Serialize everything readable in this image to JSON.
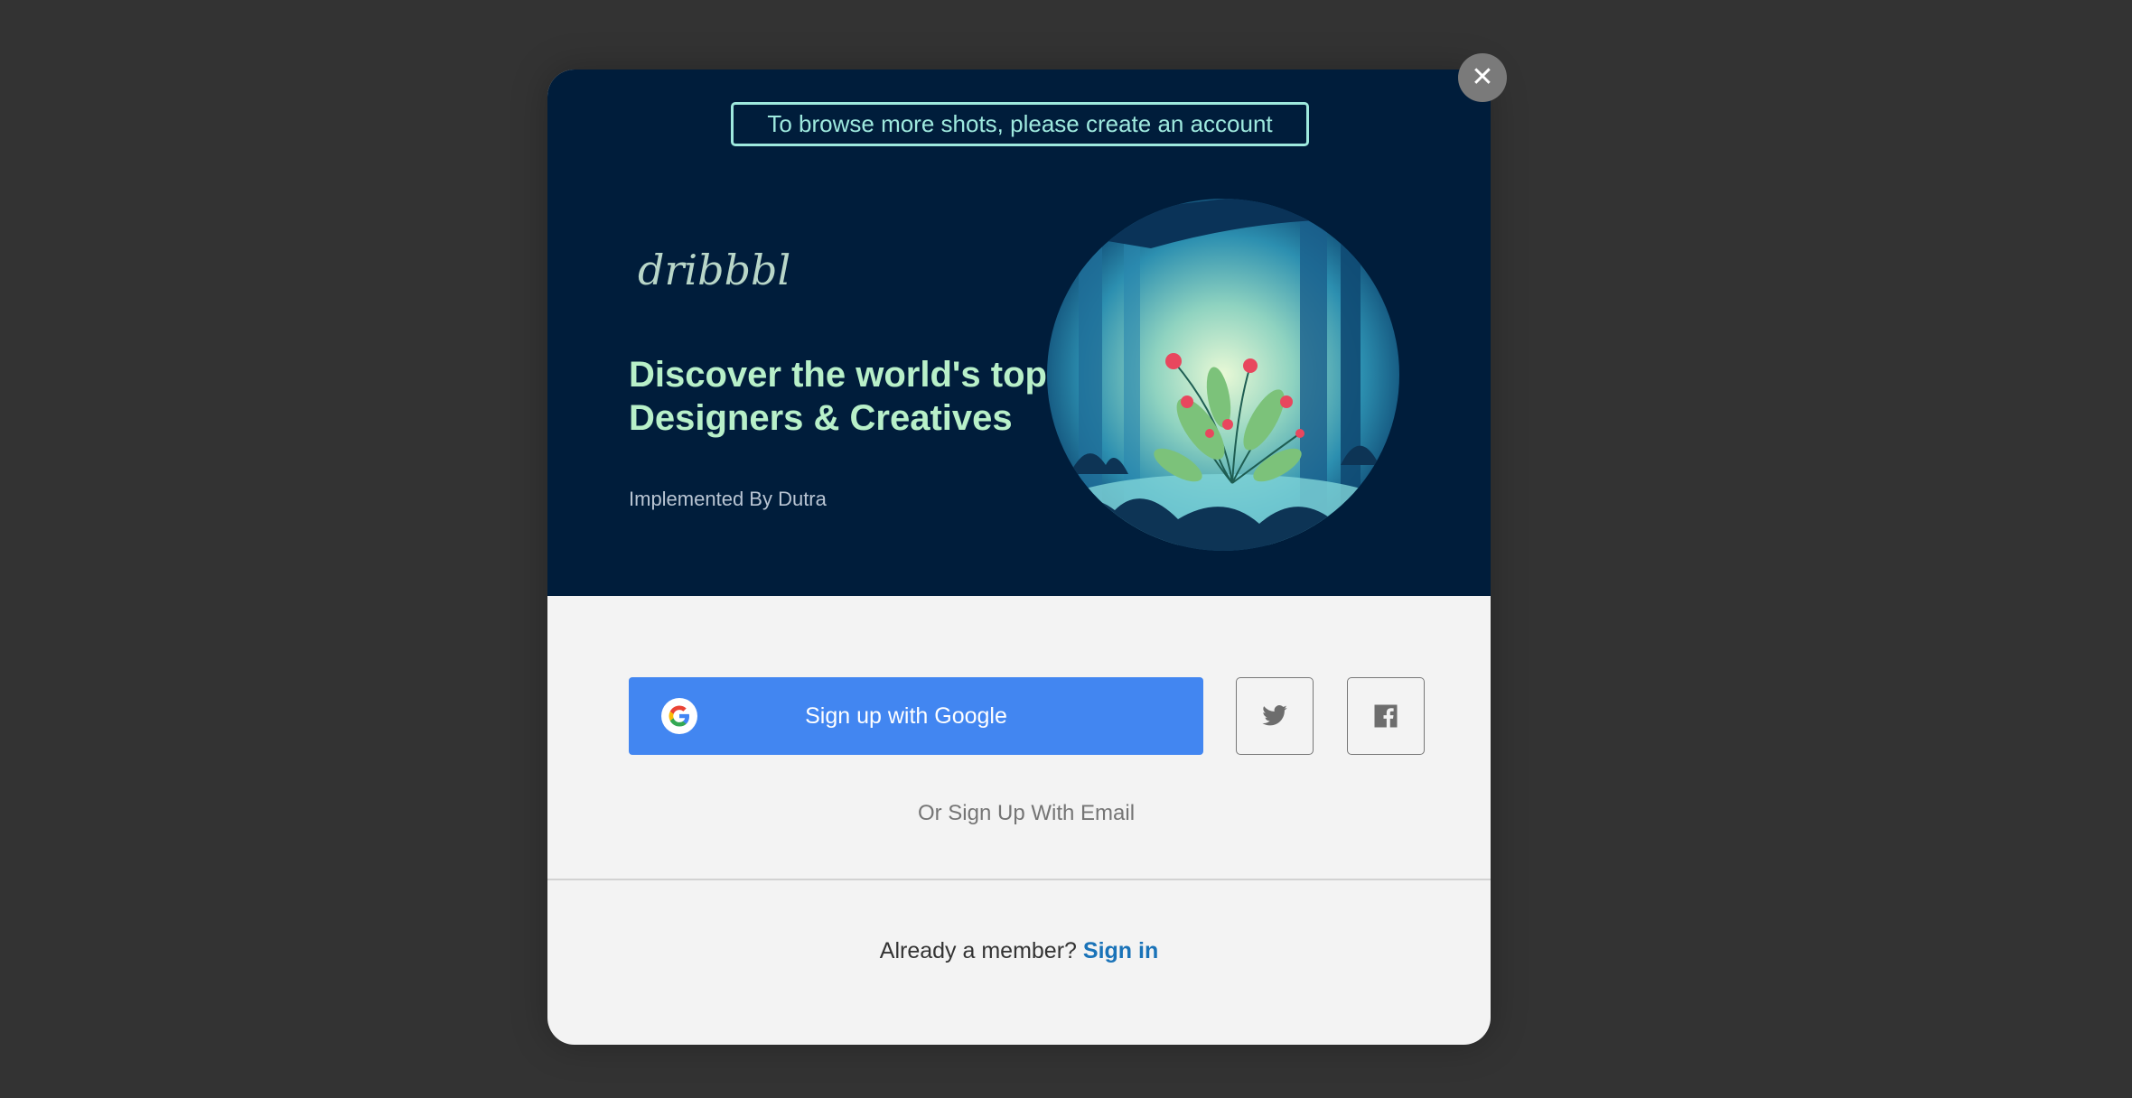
{
  "modal": {
    "notice": "To browse more shots, please create an account",
    "brand": "dribbble",
    "headline_line1": "Discover the world's top",
    "headline_line2": "Designers & Creatives",
    "credit": "Implemented By Dutra",
    "google_button_label": "Sign up with Google",
    "email_link": "Or Sign Up With Email",
    "member_text": "Already a member?",
    "signin_label": "Sign in",
    "close_label": "✕"
  },
  "colors": {
    "backdrop": "#333333",
    "hero_bg": "#001d3b",
    "accent_teal": "#9ee9de",
    "headline_green": "#b8f0c9",
    "google_blue": "#4286f1",
    "signin_link": "#1a73b8"
  },
  "icons": {
    "close": "close-icon",
    "google": "google-g-icon",
    "twitter": "twitter-icon",
    "facebook": "facebook-icon"
  }
}
